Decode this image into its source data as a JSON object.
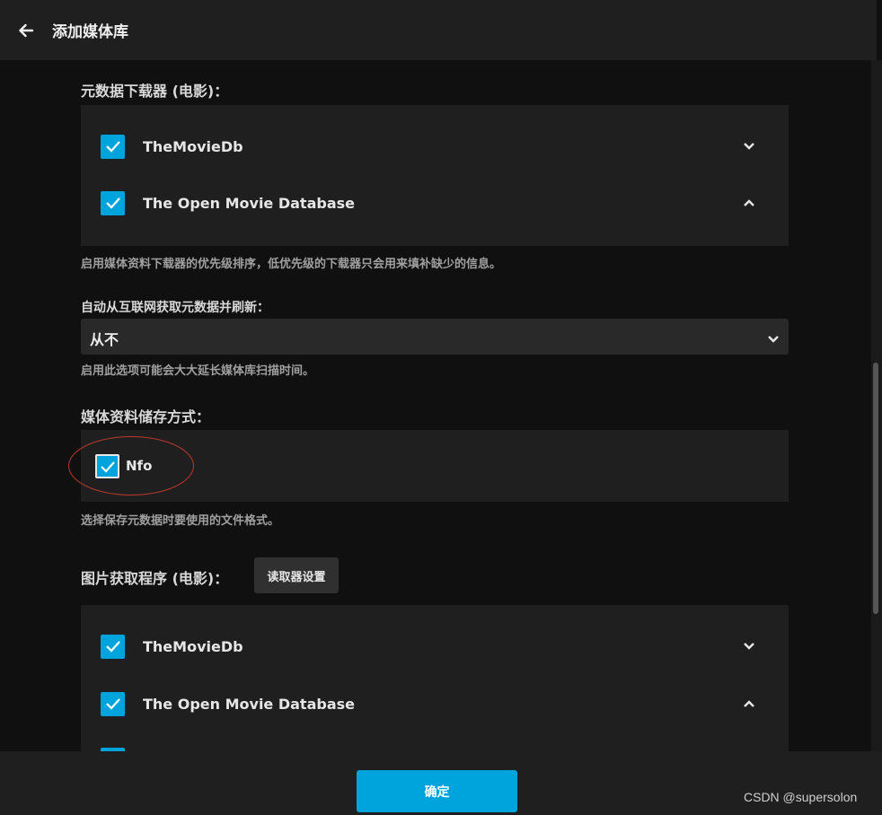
{
  "header": {
    "title": "添加媒体库"
  },
  "metadata_downloaders": {
    "label": "元数据下载器 (电影)：",
    "providers": [
      {
        "name": "TheMovieDb",
        "checked": true
      },
      {
        "name": "The Open Movie Database",
        "checked": true
      }
    ],
    "help": "启用媒体资料下载器的优先级排序，低优先级的下载器只会用来填补缺少的信息。"
  },
  "auto_refresh": {
    "label": "自动从互联网获取元数据并刷新：",
    "value": "从不",
    "help": "启用此选项可能会大大延长媒体库扫描时间。"
  },
  "metadata_savers": {
    "label": "媒体资料储存方式：",
    "option": "Nfo",
    "checked": true,
    "help": "选择保存元数据时要使用的文件格式。"
  },
  "image_fetchers": {
    "label": "图片获取程序 (电影)：",
    "settings_button": "读取器设置",
    "providers": [
      {
        "name": "TheMovieDb",
        "checked": true
      },
      {
        "name": "The Open Movie Database",
        "checked": true
      }
    ]
  },
  "footer": {
    "ok_label": "确定"
  },
  "watermark": "CSDN @supersolon",
  "colors": {
    "accent": "#00a4dc",
    "background": "#101010",
    "panel": "#1f1f1f"
  }
}
